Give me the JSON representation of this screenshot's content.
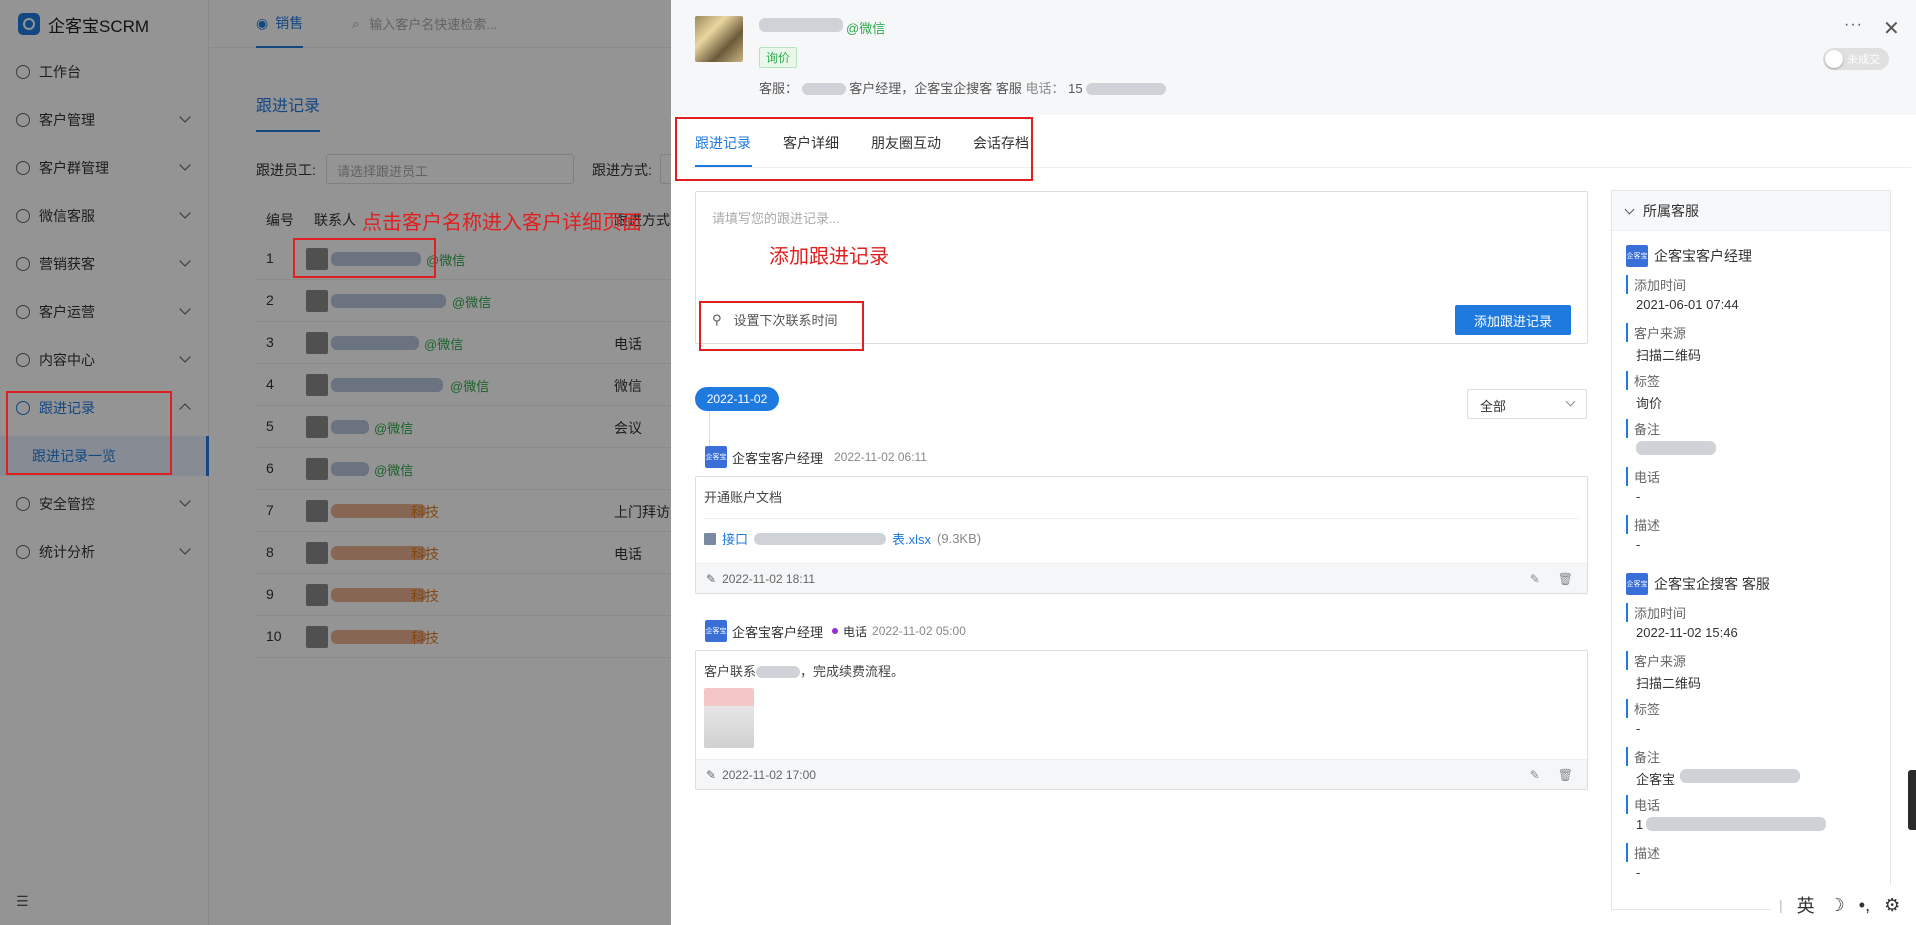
{
  "app": {
    "name": "企客宝SCRM"
  },
  "sidebar": {
    "items": [
      {
        "label": "工作台",
        "icon": "dashboard-icon"
      },
      {
        "label": "客户管理",
        "icon": "user-icon"
      },
      {
        "label": "客户群管理",
        "icon": "chat-group-icon"
      },
      {
        "label": "微信客服",
        "icon": "chat-icon"
      },
      {
        "label": "营销获客",
        "icon": "bulb-icon"
      },
      {
        "label": "客户运营",
        "icon": "chat-dots-icon"
      },
      {
        "label": "内容中心",
        "icon": "content-icon"
      },
      {
        "label": "跟进记录",
        "icon": "record-icon"
      },
      {
        "label": "安全管控",
        "icon": "shield-icon"
      },
      {
        "label": "统计分析",
        "icon": "chart-icon"
      }
    ],
    "subitem": "跟进记录一览"
  },
  "topbar": {
    "tab": "销售",
    "search_placeholder": "输入客户名快速检索..."
  },
  "main": {
    "title": "跟进记录",
    "filter_staff_label": "跟进员工:",
    "filter_staff_placeholder": "请选择跟进员工",
    "filter_way_label": "跟进方式:",
    "columns": [
      "编号",
      "联系人",
      "跟进方式"
    ],
    "rows": [
      {
        "no": "1",
        "suffix": "@微信",
        "way": ""
      },
      {
        "no": "2",
        "suffix": "@微信",
        "way": ""
      },
      {
        "no": "3",
        "suffix": "@微信",
        "way": "电话"
      },
      {
        "no": "4",
        "suffix": "@微信",
        "way": "微信"
      },
      {
        "no": "5",
        "suffix": "@微信",
        "way": "会议"
      },
      {
        "no": "6",
        "suffix": "@微信",
        "way": ""
      },
      {
        "no": "7",
        "suffix": "科技",
        "way": "上门拜访"
      },
      {
        "no": "8",
        "suffix": "科技",
        "way": "电话"
      },
      {
        "no": "9",
        "suffix": "科技",
        "way": ""
      },
      {
        "no": "10",
        "suffix": "科技",
        "way": ""
      }
    ]
  },
  "annotations": {
    "click_name": "点击客户名称进入客户详细页面",
    "add_record": "添加跟进记录"
  },
  "drawer": {
    "wechat_suffix": "@微信",
    "tag": "询价",
    "cs_label": "客服：",
    "cs_text": "客户经理，企客宝企搜客 客服",
    "phone_label": "电话：",
    "phone_prefix": "15",
    "toggle_label": "未成交",
    "more": "···",
    "close": "✕",
    "tabs": [
      "跟进记录",
      "客户详细",
      "朋友圈互动",
      "会话存档"
    ],
    "editor_placeholder": "请填写您的跟进记录...",
    "set_next": "设置下次联系时间",
    "add_button": "添加跟进记录",
    "filter": "全部",
    "date": "2022-11-02",
    "entries": [
      {
        "badge": "企客宝",
        "name": "企客宝客户经理",
        "type": "",
        "time": "2022-11-02 06:11",
        "text": "开通账户文档",
        "file_prefix": "接口",
        "file_ext": "表.xlsx",
        "file_size": "(9.3KB)",
        "footer_time": "2022-11-02 18:11"
      },
      {
        "badge": "企客宝",
        "name": "企客宝客户经理",
        "type": "电话",
        "time": "2022-11-02 05:00",
        "text": "客户联系",
        "text2": "，完成续费流程。",
        "footer_time": "2022-11-02 17:00"
      }
    ],
    "panel": {
      "title": "所属客服",
      "groups": [
        {
          "name": "企客宝客户经理",
          "fields": [
            {
              "label": "添加时间",
              "value": "2021-06-01 07:44"
            },
            {
              "label": "客户来源",
              "value": "扫描二维码"
            },
            {
              "label": "标签",
              "value": "询价"
            },
            {
              "label": "备注",
              "value": ""
            },
            {
              "label": "电话",
              "value": "-"
            },
            {
              "label": "描述",
              "value": "-"
            }
          ]
        },
        {
          "name": "企客宝企搜客 客服",
          "fields": [
            {
              "label": "添加时间",
              "value": "2022-11-02 15:46"
            },
            {
              "label": "客户来源",
              "value": "扫描二维码"
            },
            {
              "label": "标签",
              "value": "-"
            },
            {
              "label": "备注",
              "value": "企客宝"
            },
            {
              "label": "电话",
              "value": "1"
            },
            {
              "label": "描述",
              "value": "-"
            }
          ]
        }
      ]
    }
  },
  "ime": {
    "lang": "英",
    "moon": "☽",
    "punct": "•,",
    "gear": "⚙"
  },
  "colors": {
    "accent": "#1f7ae0",
    "wechat_green": "#2eaa4a",
    "annotation_red": "#e02020"
  }
}
